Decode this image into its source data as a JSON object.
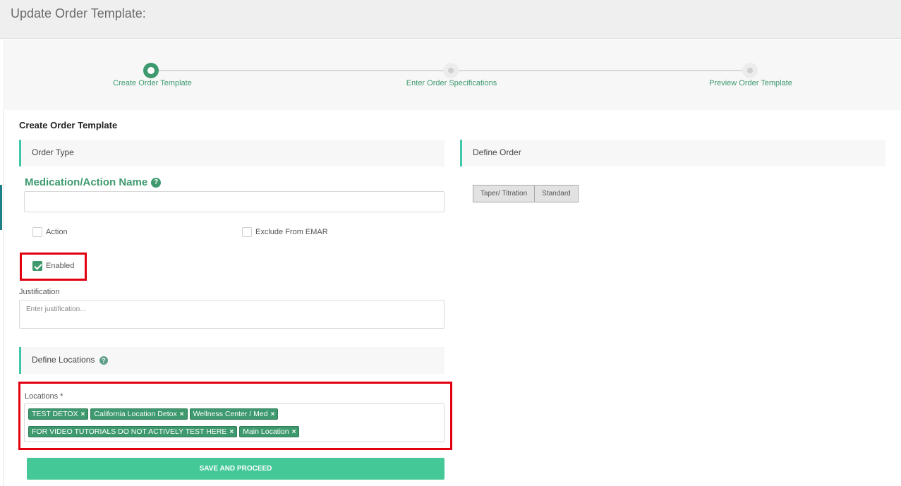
{
  "header": {
    "title": "Update Order Template:"
  },
  "steps": [
    {
      "label": "Create Order Template",
      "active": true
    },
    {
      "label": "Enter Order Specifications",
      "active": false
    },
    {
      "label": "Preview Order Template",
      "active": false
    }
  ],
  "section_heading": "Create Order Template",
  "order_type": {
    "header": "Order Type"
  },
  "medication": {
    "label": "Medication/Action Name",
    "value": ""
  },
  "checkboxes": {
    "action": {
      "label": "Action",
      "checked": false
    },
    "exclude_emar": {
      "label": "Exclude From EMAR",
      "checked": false
    },
    "enabled": {
      "label": "Enabled",
      "checked": true
    }
  },
  "justification": {
    "label": "Justification",
    "placeholder": "Enter justification..."
  },
  "define_locations": {
    "header": "Define Locations"
  },
  "locations": {
    "label": "Locations *",
    "tags": [
      "TEST DETOX",
      "California Location Detox",
      "Wellness Center / Med",
      "FOR VIDEO TUTORIALS DO NOT ACTIVELY TEST HERE",
      "Main Location"
    ]
  },
  "define_order": {
    "header": "Define Order",
    "buttons": [
      "Taper/ Titration",
      "Standard"
    ]
  },
  "save_button": "SAVE AND PROCEED",
  "colors": {
    "accent": "#3e9a6e",
    "save": "#45c898",
    "highlight": "#e0000f",
    "teal_bar": "#3fc8a7"
  }
}
